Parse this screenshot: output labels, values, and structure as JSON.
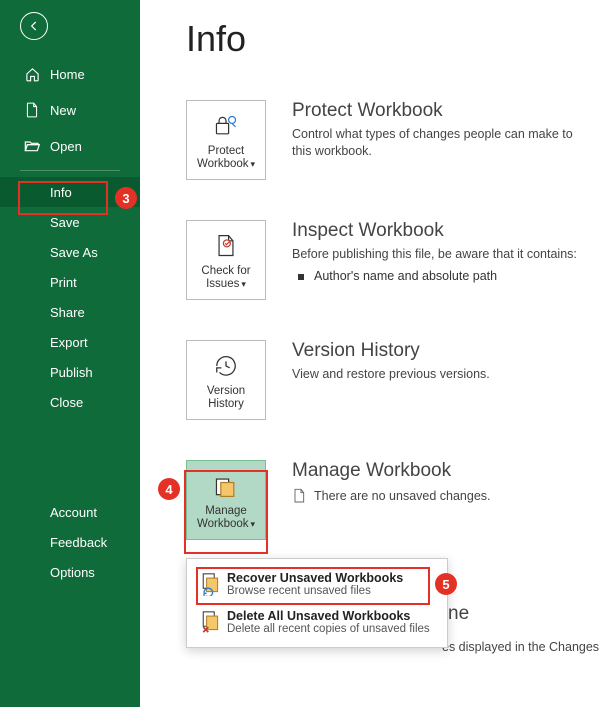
{
  "sidebar": {
    "items": [
      {
        "label": "Home"
      },
      {
        "label": "New"
      },
      {
        "label": "Open"
      },
      {
        "label": "Info"
      },
      {
        "label": "Save"
      },
      {
        "label": "Save As"
      },
      {
        "label": "Print"
      },
      {
        "label": "Share"
      },
      {
        "label": "Export"
      },
      {
        "label": "Publish"
      },
      {
        "label": "Close"
      },
      {
        "label": "Account"
      },
      {
        "label": "Feedback"
      },
      {
        "label": "Options"
      }
    ]
  },
  "page": {
    "title": "Info"
  },
  "sections": {
    "protect": {
      "tile": "Protect Workbook",
      "title": "Protect Workbook",
      "desc": "Control what types of changes people can make to this workbook."
    },
    "inspect": {
      "tile": "Check for Issues",
      "title": "Inspect Workbook",
      "desc": "Before publishing this file, be aware that it contains:",
      "bullet": "Author's name and absolute path"
    },
    "version": {
      "tile": "Version History",
      "title": "Version History",
      "desc": "View and restore previous versions."
    },
    "manage": {
      "tile": "Manage Workbook",
      "title": "Manage Workbook",
      "desc": "There are no unsaved changes."
    },
    "changes": {
      "title_fragment": "ne",
      "desc_fragment": "es displayed in the Changes"
    }
  },
  "dropdown": {
    "recover": {
      "title": "Recover Unsaved Workbooks",
      "sub": "Browse recent unsaved files"
    },
    "delete": {
      "title": "Delete All Unsaved Workbooks",
      "sub": "Delete all recent copies of unsaved files"
    }
  },
  "annotations": {
    "c3": "3",
    "c4": "4",
    "c5": "5"
  }
}
